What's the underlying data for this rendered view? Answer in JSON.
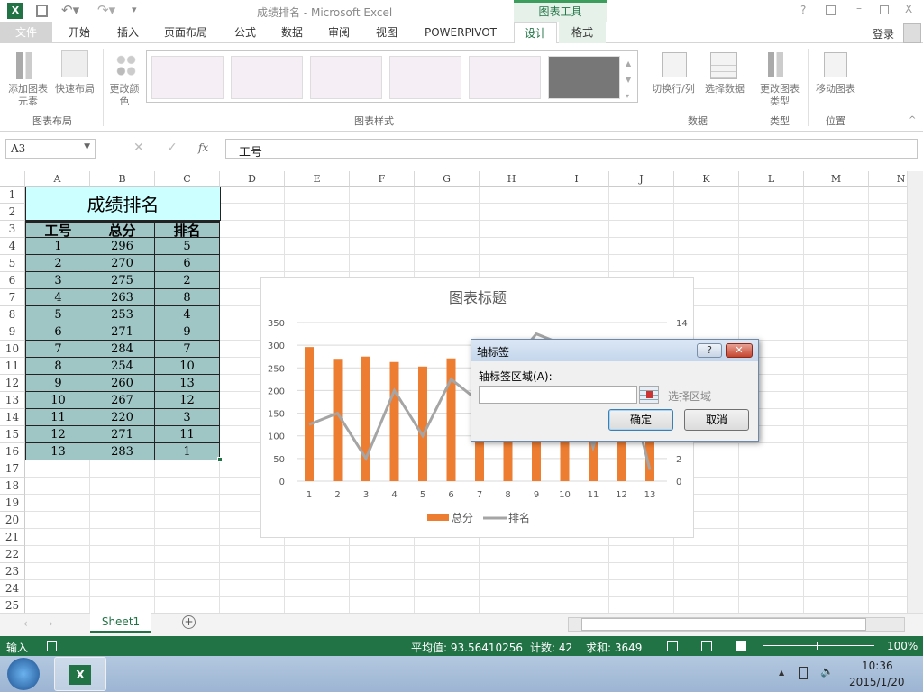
{
  "window": {
    "title": "成绩排名 - Microsoft Excel",
    "tool_context": "图表工具",
    "help": "?",
    "signin": "登录"
  },
  "tabs": [
    {
      "label": "文件"
    },
    {
      "label": "开始"
    },
    {
      "label": "插入"
    },
    {
      "label": "页面布局"
    },
    {
      "label": "公式"
    },
    {
      "label": "数据"
    },
    {
      "label": "审阅"
    },
    {
      "label": "视图"
    },
    {
      "label": "POWERPIVOT"
    },
    {
      "label": "设计",
      "active": true
    },
    {
      "label": "格式"
    }
  ],
  "ribbon": {
    "add_element": "添加图表元素",
    "quick_layout": "快速布局",
    "change_color": "更改颜色",
    "group_layout": "图表布局",
    "group_styles": "图表样式",
    "switch_rowcol": "切换行/列",
    "select_data": "选择数据",
    "group_data": "数据",
    "change_type": "更改图表类型",
    "group_type": "类型",
    "move_chart": "移动图表",
    "group_location": "位置"
  },
  "formula_bar": {
    "name_box": "A3",
    "fx": "fx",
    "value": "工号"
  },
  "columns": [
    "A",
    "B",
    "C",
    "D",
    "E",
    "F",
    "G",
    "H",
    "I",
    "J",
    "K",
    "L",
    "M",
    "N"
  ],
  "rows": [
    "1",
    "2",
    "3",
    "4",
    "5",
    "6",
    "7",
    "8",
    "9",
    "10",
    "11",
    "12",
    "13",
    "14",
    "15",
    "16",
    "17",
    "18",
    "19",
    "20",
    "21",
    "22",
    "23",
    "24",
    "25"
  ],
  "table": {
    "title": "成绩排名",
    "headers": [
      "工号",
      "总分",
      "排名"
    ],
    "rows": [
      [
        "1",
        "296",
        "5"
      ],
      [
        "2",
        "270",
        "6"
      ],
      [
        "3",
        "275",
        "2"
      ],
      [
        "4",
        "263",
        "8"
      ],
      [
        "5",
        "253",
        "4"
      ],
      [
        "6",
        "271",
        "9"
      ],
      [
        "7",
        "284",
        "7"
      ],
      [
        "8",
        "254",
        "10"
      ],
      [
        "9",
        "260",
        "13"
      ],
      [
        "10",
        "267",
        "12"
      ],
      [
        "11",
        "220",
        "3"
      ],
      [
        "12",
        "271",
        "11"
      ],
      [
        "13",
        "283",
        "1"
      ]
    ]
  },
  "chart_data": {
    "type": "bar+line",
    "title": "图表标题",
    "categories": [
      "1",
      "2",
      "3",
      "4",
      "5",
      "6",
      "7",
      "8",
      "9",
      "10",
      "11",
      "12",
      "13"
    ],
    "series": [
      {
        "name": "总分",
        "type": "bar",
        "axis": "left",
        "color": "#ed7d31",
        "values": [
          296,
          270,
          275,
          263,
          253,
          271,
          284,
          254,
          260,
          267,
          220,
          271,
          283
        ]
      },
      {
        "name": "排名",
        "type": "line",
        "axis": "right",
        "color": "#a5a5a5",
        "values": [
          5,
          6,
          2,
          8,
          4,
          9,
          7,
          10,
          13,
          12,
          3,
          11,
          1
        ]
      }
    ],
    "ylim": [
      0,
      350
    ],
    "yticks": [
      "0",
      "50",
      "100",
      "150",
      "200",
      "250",
      "300",
      "350"
    ],
    "y2lim": [
      0,
      14
    ],
    "y2ticks": [
      "0",
      "2",
      "4",
      "6",
      "8",
      "10",
      "12",
      "14"
    ],
    "grid": true,
    "legend": "bottom"
  },
  "dialog": {
    "title": "轴标签",
    "label": "轴标签区域(A):",
    "input_value": "",
    "hint": "选择区域",
    "ok": "确定",
    "cancel": "取消"
  },
  "sheets": [
    {
      "label": "Sheet1"
    }
  ],
  "status": {
    "mode": "输入",
    "average": "平均值: 93.56410256",
    "count": "计数: 42",
    "sum": "求和: 3649",
    "zoom": "100%"
  },
  "taskbar": {
    "time": "10:36",
    "date": "2015/1/20"
  }
}
